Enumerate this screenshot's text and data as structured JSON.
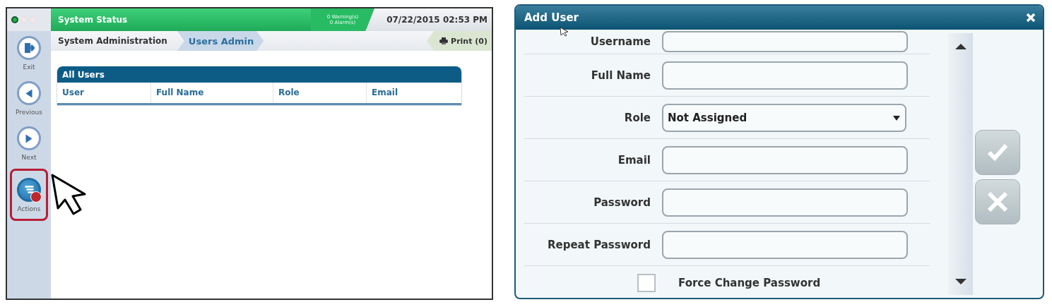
{
  "status_screen": {
    "status_bar": {
      "lights": [
        {
          "on": true
        },
        {
          "on": false
        },
        {
          "on": false
        }
      ],
      "title": "System Status",
      "warnings": "0 Warning(s)",
      "alarms": "0 Alarm(s)",
      "datetime": "07/22/2015 02:53 PM"
    },
    "sidebar": {
      "items": [
        {
          "kind": "exit",
          "label": "Exit",
          "highlighted": false
        },
        {
          "kind": "previous",
          "label": "Previous",
          "highlighted": false
        },
        {
          "kind": "next",
          "label": "Next",
          "highlighted": false
        },
        {
          "kind": "actions",
          "label": "Actions",
          "highlighted": true
        }
      ]
    },
    "breadcrumb": [
      {
        "label": "System Administration",
        "selected": false
      },
      {
        "label": "Users Admin",
        "selected": true
      }
    ],
    "print_button": "Print (0)",
    "table": {
      "title": "All Users",
      "columns": [
        "User",
        "Full Name",
        "Role",
        "Email"
      ]
    }
  },
  "dialog": {
    "title": "Add User",
    "fields": [
      {
        "kind": "text",
        "label": "Username"
      },
      {
        "kind": "text",
        "label": "Full Name"
      },
      {
        "kind": "select",
        "label": "Role",
        "value": "Not Assigned"
      },
      {
        "kind": "text",
        "label": "Email"
      },
      {
        "kind": "text",
        "label": "Password"
      },
      {
        "kind": "text",
        "label": "Repeat Password"
      }
    ],
    "checkboxes": [
      {
        "label": "Force Change Password",
        "checked": false
      }
    ],
    "buttons": [
      {
        "kind": "confirm",
        "disabled": true
      },
      {
        "kind": "cancel",
        "disabled": true
      }
    ]
  }
}
